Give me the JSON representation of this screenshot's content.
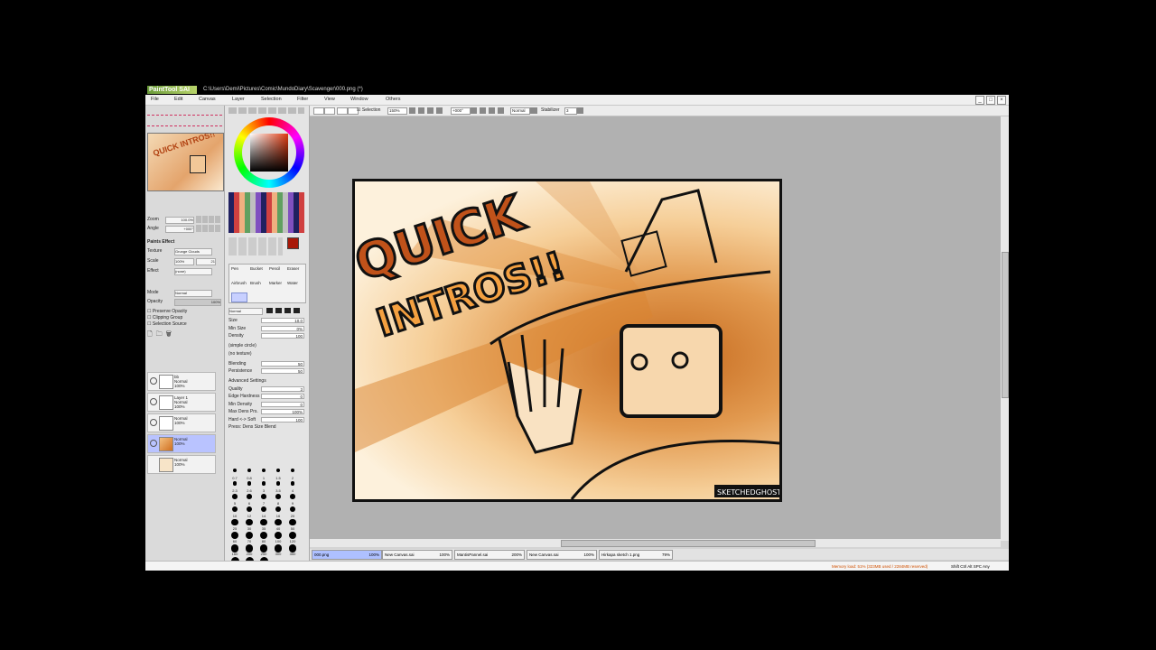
{
  "titlebar": {
    "app_logo": "PaintTool SAI",
    "path": "C:\\Users\\Demi\\Pictures\\Comic\\MundoDiary\\Scavenger\\000.png (*)"
  },
  "menu": [
    "File",
    "Edit",
    "Canvas",
    "Layer",
    "Selection",
    "Filter",
    "View",
    "Window",
    "Others"
  ],
  "window_buttons": [
    "_",
    "□",
    "×"
  ],
  "nav": {
    "zoom_label": "Zoom",
    "zoom_value": "100.0%",
    "angle_label": "Angle",
    "angle_value": "+000°",
    "paints_effect": "Paints Effect",
    "texture_label": "Texture",
    "texture_value": "Grunge Clouds",
    "scale_label": "Scale",
    "scale_value": "100%",
    "scale_num": "21",
    "effect_label": "Effect",
    "effect_value": "(none)",
    "mode_label": "Mode",
    "mode_value": "Normal",
    "opacity_label": "Opacity",
    "opacity_value": "100%",
    "preserve_opacity": "Preserve Opacity",
    "clipping_group": "Clipping Group",
    "selection_source": "Selection Source",
    "thumb_text": "QUICK INTROS!!",
    "layers": [
      {
        "name": "bb",
        "mode": "Normal",
        "opacity": "100%",
        "selected": false
      },
      {
        "name": "Layer 1",
        "mode": "Normal",
        "opacity": "100%",
        "selected": false
      },
      {
        "name": "",
        "mode": "Normal",
        "opacity": "100%",
        "selected": false
      },
      {
        "name": "",
        "mode": "Normal",
        "opacity": "100%",
        "selected": true
      },
      {
        "name": "",
        "mode": "Normal",
        "opacity": "100%",
        "selected": false
      }
    ]
  },
  "tools": {
    "brush_names": [
      "Pen",
      "Bucket",
      "Pencil",
      "Eraser",
      "Airbrush",
      "Brush",
      "Marker",
      "Water"
    ],
    "mode_value": "Normal",
    "props": [
      {
        "label": "Size",
        "value": "10.0"
      },
      {
        "label": "Min Size",
        "value": "0%"
      },
      {
        "label": "Density",
        "value": "100"
      },
      {
        "label": "(simple circle)",
        "value": ""
      },
      {
        "label": "(no texture)",
        "value": ""
      },
      {
        "label": "Blending",
        "value": "50"
      },
      {
        "label": "Persistence",
        "value": "50"
      },
      {
        "label": "Advanced Settings",
        "value": ""
      },
      {
        "label": "Quality",
        "value": "3"
      },
      {
        "label": "Edge Hardness",
        "value": "0"
      },
      {
        "label": "Min Density",
        "value": "0"
      },
      {
        "label": "Max Dens Prs.",
        "value": "100%"
      },
      {
        "label": "Hard <-> Soft",
        "value": "100"
      },
      {
        "label": "Press: Dens Size Blend",
        "value": ""
      }
    ],
    "sizes": [
      "0.7",
      "0.8",
      "1",
      "1.5",
      "2",
      "2.3",
      "2.6",
      "3",
      "3.5",
      "4",
      "5",
      "6",
      "7",
      "8",
      "9",
      "10",
      "12",
      "14",
      "16",
      "20",
      "25",
      "30",
      "35",
      "40",
      "50",
      "60",
      "70",
      "80",
      "100",
      "120",
      "160",
      "200",
      "250",
      "300",
      "350",
      "400",
      "450",
      "500"
    ]
  },
  "toolbar": {
    "selection_label": "Selection",
    "zoom_value": "150%",
    "angle_value": "+000°",
    "mode_value": "Normal",
    "stabilizer_label": "Stabilizer",
    "stabilizer_value": "3"
  },
  "artwork": {
    "title_line1": "QUICK",
    "title_line2": "INTROS!!",
    "signature": "SKETCHEDGHOST"
  },
  "tabs": [
    {
      "name": "000.png",
      "zoom": "100%",
      "active": true
    },
    {
      "name": "New Canvas.sai",
      "zoom": "100%",
      "active": false
    },
    {
      "name": "MantisPannel.sai",
      "zoom": "200%",
      "active": false
    },
    {
      "name": "New Canvas.sai",
      "zoom": "100%",
      "active": false
    },
    {
      "name": "Hirkapa sketch 1.png",
      "zoom": "79%",
      "active": false
    }
  ],
  "status": {
    "memory": "Memory load: 51% (323MB used / 2284MB reserved)",
    "keys": "Shift Ctrl Alt SPC Any"
  },
  "colors": {
    "accent_selected": "#b9c3ff",
    "tab_active": "#aec0ff",
    "current_color": "#a81808",
    "status_memory": "#d05000"
  }
}
